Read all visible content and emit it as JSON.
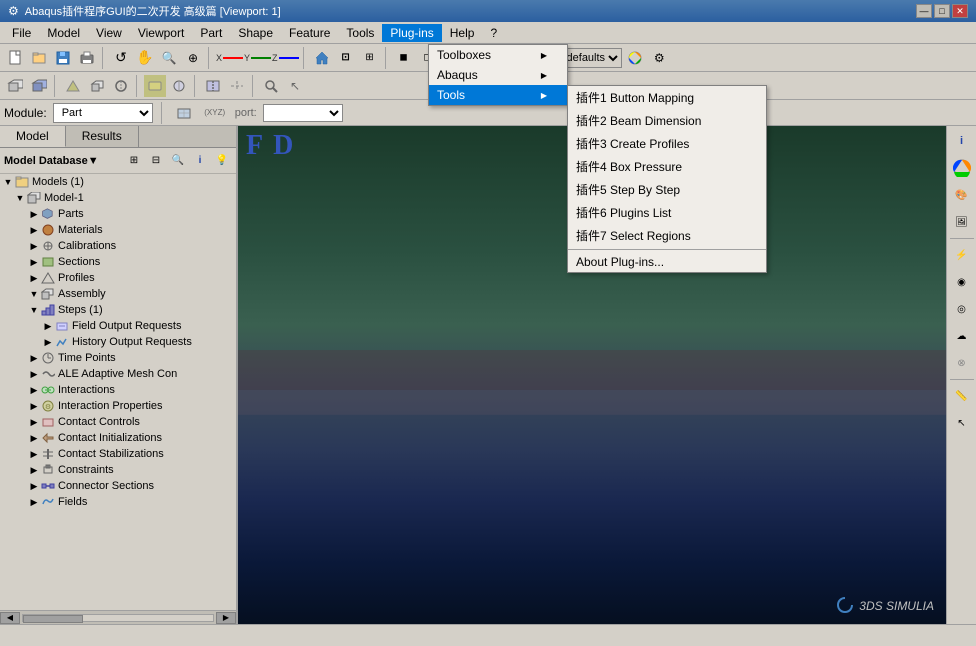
{
  "titleBar": {
    "title": "Abaqus插件程序GUI的二次开发 高级篇 [Viewport: 1]",
    "controls": [
      "—",
      "□",
      "✕"
    ]
  },
  "menuBar": {
    "items": [
      "File",
      "Model",
      "View",
      "Viewport",
      "Part",
      "Shape",
      "Feature",
      "Tools",
      "Plug-ins",
      "Help",
      "?"
    ]
  },
  "toolbar1": {
    "buttons": [
      "📁",
      "💾",
      "🖨",
      "📋",
      "↩",
      "↪",
      "🔍",
      "📐",
      "🔧",
      "⚙"
    ]
  },
  "toolbar2": {
    "moduleLabel": "Module:",
    "moduleValue": "Part",
    "portLabel": "port:",
    "portValue": ""
  },
  "tabs": [
    "Model",
    "Results"
  ],
  "modelTree": {
    "header": "Model Database",
    "items": [
      {
        "id": "models",
        "label": "Models (1)",
        "indent": 0,
        "expand": "▼",
        "icon": "🗃"
      },
      {
        "id": "model1",
        "label": "Model-1",
        "indent": 1,
        "expand": "▼",
        "icon": "📦"
      },
      {
        "id": "parts",
        "label": "Parts",
        "indent": 2,
        "expand": "▶",
        "icon": "🔩"
      },
      {
        "id": "materials",
        "label": "Materials",
        "indent": 2,
        "expand": "▶",
        "icon": "🧱"
      },
      {
        "id": "calibrations",
        "label": "Calibrations",
        "indent": 2,
        "expand": "▶",
        "icon": "📏"
      },
      {
        "id": "sections",
        "label": "Sections",
        "indent": 2,
        "expand": "▶",
        "icon": "📋"
      },
      {
        "id": "profiles",
        "label": "Profiles",
        "indent": 2,
        "expand": "▶",
        "icon": "📐"
      },
      {
        "id": "assembly",
        "label": "Assembly",
        "indent": 2,
        "expand": "▼",
        "icon": "🔧"
      },
      {
        "id": "steps",
        "label": "Steps (1)",
        "indent": 2,
        "expand": "▼",
        "icon": "👣"
      },
      {
        "id": "fieldoutput",
        "label": "Field Output Requests",
        "indent": 3,
        "expand": "▶",
        "icon": "📊"
      },
      {
        "id": "histoutput",
        "label": "History Output Requests",
        "indent": 3,
        "expand": "▶",
        "icon": "📈"
      },
      {
        "id": "timepoints",
        "label": "Time Points",
        "indent": 2,
        "expand": "▶",
        "icon": "⏱"
      },
      {
        "id": "ale",
        "label": "ALE Adaptive Mesh Con",
        "indent": 2,
        "expand": "▶",
        "icon": "🔀"
      },
      {
        "id": "interactions",
        "label": "Interactions",
        "indent": 2,
        "expand": "▶",
        "icon": "🔗"
      },
      {
        "id": "interactionprops",
        "label": "Interaction Properties",
        "indent": 2,
        "expand": "▶",
        "icon": "⚙"
      },
      {
        "id": "contactcontrols",
        "label": "Contact Controls",
        "indent": 2,
        "expand": "▶",
        "icon": "🎛"
      },
      {
        "id": "contactinit",
        "label": "Contact Initializations",
        "indent": 2,
        "expand": "▶",
        "icon": "🔄"
      },
      {
        "id": "contactstab",
        "label": "Contact Stabilizations",
        "indent": 2,
        "expand": "▶",
        "icon": "📌"
      },
      {
        "id": "constraints",
        "label": "Constraints",
        "indent": 2,
        "expand": "▶",
        "icon": "🔒"
      },
      {
        "id": "connectorsections",
        "label": "Connector Sections",
        "indent": 2,
        "expand": "▶",
        "icon": "🔌"
      },
      {
        "id": "fields",
        "label": "Fields",
        "indent": 2,
        "expand": "▶",
        "icon": "📡"
      }
    ]
  },
  "pluginsMenu": {
    "label": "Plug-ins",
    "items": [
      {
        "id": "toolboxes",
        "label": "Toolboxes",
        "hasSubmenu": true
      },
      {
        "id": "abaqus",
        "label": "Abaqus",
        "hasSubmenu": true
      },
      {
        "id": "tools",
        "label": "Tools",
        "hasSubmenu": true,
        "highlighted": true
      }
    ],
    "toolsSubmenu": [
      {
        "id": "plugin1",
        "label": "插件1 Button Mapping"
      },
      {
        "id": "plugin2",
        "label": "插件2 Beam Dimension"
      },
      {
        "id": "plugin3",
        "label": "插件3 Create Profiles"
      },
      {
        "id": "plugin4",
        "label": "插件4 Box Pressure"
      },
      {
        "id": "plugin5",
        "label": "插件5 Step By Step"
      },
      {
        "id": "plugin6",
        "label": "插件6 Plugins List"
      },
      {
        "id": "plugin7",
        "label": "插件7 Select Regions"
      },
      {
        "separator": true
      },
      {
        "id": "aboutplugins",
        "label": "About Plug-ins..."
      }
    ]
  },
  "viewport": {
    "fdLabel": "F D",
    "logo": "3DS SIMULIA"
  },
  "statusBar": {
    "text": ""
  }
}
